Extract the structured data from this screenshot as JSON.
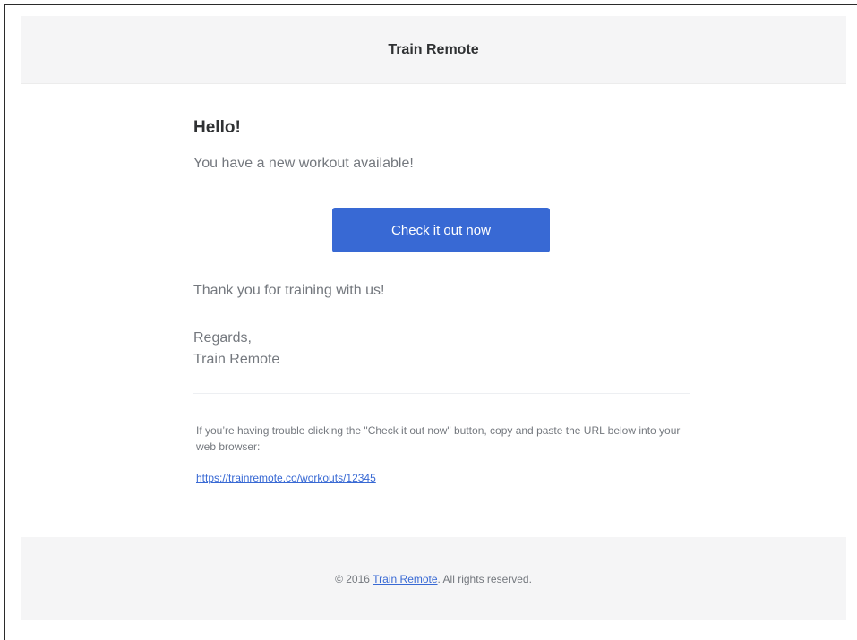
{
  "email": {
    "brand": "Train Remote",
    "greeting": "Hello!",
    "intro": "You have a new workout available!",
    "action_label": "Check it out now",
    "outro": "Thank you for training with us!",
    "salutation": "Regards,",
    "signature": "Train Remote",
    "subcopy": "If you’re having trouble clicking the \"Check it out now\" button, copy and paste the URL below into your web browser:",
    "action_url": "https://trainremote.co/workouts/12345"
  },
  "footer": {
    "copyright_prefix": "© 2016 ",
    "brand_link": "Train Remote",
    "copyright_suffix": ". All rights reserved."
  },
  "colors": {
    "header_bg": "#f5f5f6",
    "button_bg": "#3869d4",
    "text_muted": "#74787e",
    "text_dark": "#2f3133",
    "link": "#3869d4"
  }
}
